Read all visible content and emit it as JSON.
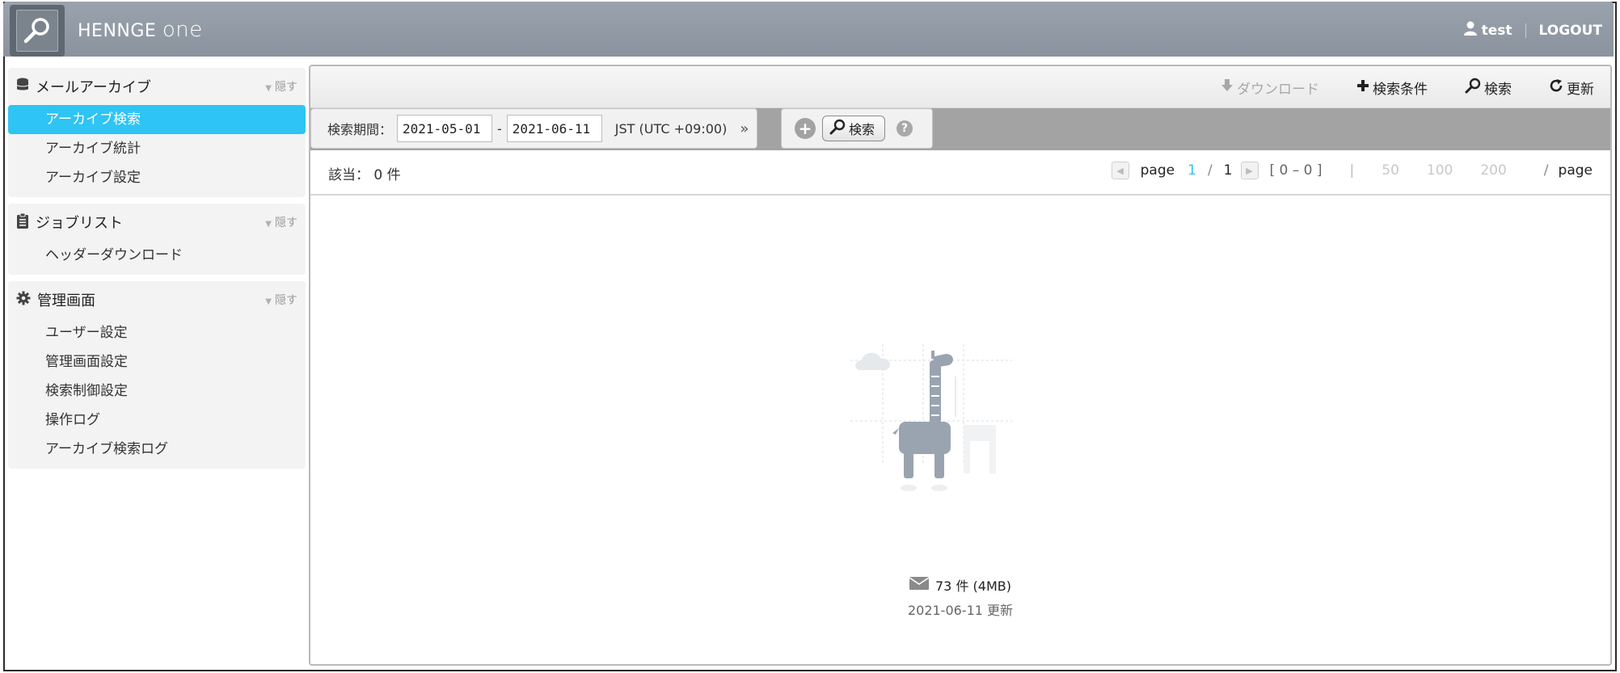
{
  "header": {
    "brand": "HENNGE",
    "brand_suffix": "one",
    "username": "test",
    "logout": "LOGOUT"
  },
  "sidebar": {
    "sections": [
      {
        "title": "メールアーカイブ",
        "hide": "隠す",
        "icon": "database-icon",
        "items": [
          "アーカイブ検索",
          "アーカイブ統計",
          "アーカイブ設定"
        ],
        "active_index": 0
      },
      {
        "title": "ジョブリスト",
        "hide": "隠す",
        "icon": "clipboard-icon",
        "items": [
          "ヘッダーダウンロード"
        ]
      },
      {
        "title": "管理画面",
        "hide": "隠す",
        "icon": "gear-icon",
        "items": [
          "ユーザー設定",
          "管理画面設定",
          "検索制御設定",
          "操作ログ",
          "アーカイブ検索ログ"
        ]
      }
    ]
  },
  "toolbar": {
    "download": "ダウンロード",
    "conditions": "検索条件",
    "search": "検索",
    "refresh": "更新"
  },
  "filter": {
    "period_label": "検索期間：",
    "date_from": "2021-05-01",
    "date_sep": "-",
    "date_to": "2021-06-11",
    "timezone": "JST (UTC +09:00)",
    "expand": "»",
    "search_button": "検索",
    "help": "?"
  },
  "results": {
    "count_label": "該当：",
    "count_value": "0 件",
    "page_label": "page",
    "current_page": "1",
    "page_sep": "/",
    "total_pages": "1",
    "range": "[ 0 – 0 ]",
    "divider": "|",
    "per_page_options": [
      "50",
      "100",
      "200"
    ],
    "per_page_sep": "/",
    "per_page_label": "page"
  },
  "empty_state": {
    "mail_count": "73 件 (4MB)",
    "updated": "2021-06-11 更新"
  },
  "colors": {
    "accent": "#2ec4f3",
    "header": "#8f98a2",
    "giraffe": "#9aa4b0"
  }
}
